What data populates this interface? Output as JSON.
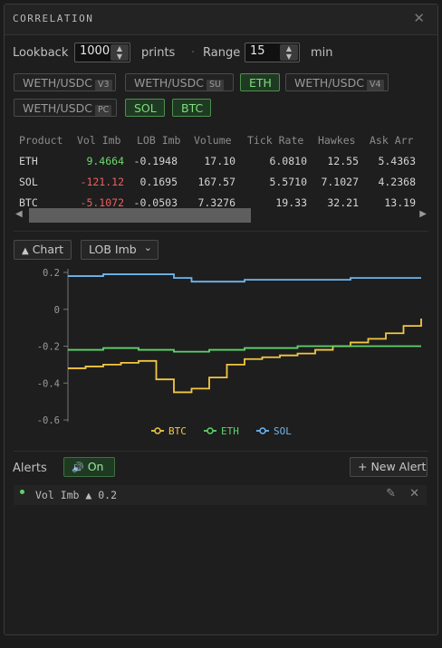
{
  "panel": {
    "title": "CORRELATION",
    "close_label": "✕"
  },
  "controls": {
    "lookback_label": "Lookback",
    "lookback_value": "1000",
    "prints_label": "prints",
    "dot": "·",
    "range_label": "Range",
    "range_value": "15",
    "min_label": "min"
  },
  "chips": [
    {
      "label": "WETH/USDC",
      "tag": "V3",
      "active": false
    },
    {
      "label": "WETH/USDC",
      "tag": "SU",
      "active": false
    },
    {
      "label": "ETH",
      "tag": "",
      "active": true
    },
    {
      "label": "WETH/USDC",
      "tag": "V4",
      "active": false
    },
    {
      "label": "WETH/USDC",
      "tag": "PC",
      "active": false
    },
    {
      "label": "SOL",
      "tag": "",
      "active": true
    },
    {
      "label": "BTC",
      "tag": "",
      "active": true
    }
  ],
  "table": {
    "headers": [
      "Product",
      "Vol Imb",
      "LOB Imb",
      "Volume",
      "Tick Rate",
      "Hawkes",
      "Ask Arr"
    ],
    "rows": [
      [
        "ETH",
        "9.4664",
        "-0.1948",
        "17.10",
        "6.0810",
        "12.55",
        "5.4363"
      ],
      [
        "SOL",
        "-121.12",
        "0.1695",
        "167.57",
        "5.5710",
        "7.1027",
        "4.2368"
      ],
      [
        "BTC",
        "-5.1072",
        "-0.0503",
        "7.3276",
        "19.33",
        "32.21",
        "13.19"
      ]
    ],
    "scroll_position": 0
  },
  "chart_controls": {
    "chart_button": "Chart",
    "chart_icon": "triangle-up-icon",
    "metric_value": "LOB Imb"
  },
  "chart_data": {
    "type": "line",
    "yticks": [
      "0.2",
      "0",
      "-0.2",
      "-0.4",
      "-0.6"
    ],
    "ylim": [
      -0.6,
      0.2
    ],
    "x": [
      0,
      5,
      10,
      15,
      20,
      25,
      30,
      35,
      40,
      45,
      50,
      55,
      60,
      65,
      70,
      75,
      80,
      85,
      90,
      95,
      100
    ],
    "series": [
      {
        "name": "BTC",
        "color": "#f2c744",
        "values": [
          -0.32,
          -0.31,
          -0.3,
          -0.29,
          -0.28,
          -0.38,
          -0.45,
          -0.43,
          -0.37,
          -0.3,
          -0.27,
          -0.26,
          -0.25,
          -0.24,
          -0.22,
          -0.2,
          -0.18,
          -0.16,
          -0.13,
          -0.09,
          -0.05
        ]
      },
      {
        "name": "ETH",
        "color": "#5fd36b",
        "values": [
          -0.22,
          -0.22,
          -0.21,
          -0.21,
          -0.22,
          -0.22,
          -0.23,
          -0.23,
          -0.22,
          -0.22,
          -0.21,
          -0.21,
          -0.21,
          -0.2,
          -0.2,
          -0.2,
          -0.2,
          -0.2,
          -0.2,
          -0.2,
          -0.2
        ]
      },
      {
        "name": "SOL",
        "color": "#6fb6ee",
        "values": [
          0.18,
          0.18,
          0.19,
          0.19,
          0.19,
          0.19,
          0.17,
          0.15,
          0.15,
          0.15,
          0.16,
          0.16,
          0.16,
          0.16,
          0.16,
          0.16,
          0.17,
          0.17,
          0.17,
          0.17,
          0.17
        ]
      }
    ]
  },
  "alerts": {
    "label": "Alerts",
    "toggle_label": "On",
    "toggle_icon": "speaker-icon",
    "new_alert_label": "+ New Alert",
    "items": [
      {
        "text": "Vol Imb ▲ 0.2",
        "status_color": "#5fd36b"
      }
    ]
  }
}
